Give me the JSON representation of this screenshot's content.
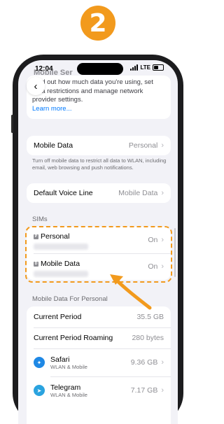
{
  "step": {
    "number": "2"
  },
  "status_bar": {
    "time": "12:04",
    "network": "LTE",
    "icons": [
      "signal-icon",
      "battery-icon"
    ]
  },
  "nav": {
    "title": "Mobile Ser",
    "back_icon": "chevron-left-icon"
  },
  "intro": {
    "text": "Find out how much data you're using, set data restrictions and manage network provider settings.",
    "learn_more": "Learn more..."
  },
  "mobile_data": {
    "label": "Mobile Data",
    "value": "Personal",
    "footnote": "Turn off mobile data to restrict all data to WLAN, including email, web browsing and push notifications."
  },
  "voice_line": {
    "label": "Default Voice Line",
    "value": "Mobile Data"
  },
  "sims": {
    "header": "SIMs",
    "items": [
      {
        "badge": "P",
        "label": "Personal",
        "status": "On"
      },
      {
        "badge": "D",
        "label": "Mobile Data",
        "status": "On"
      }
    ]
  },
  "usage": {
    "header": "Mobile Data For Personal",
    "current_period": {
      "label": "Current Period",
      "value": "35.5 GB"
    },
    "roaming": {
      "label": "Current Period Roaming",
      "value": "280 bytes"
    },
    "apps": [
      {
        "name": "Safari",
        "subtitle": "WLAN & Mobile",
        "value": "9.36 GB",
        "icon": "safari-icon",
        "color": "#1e88e5"
      },
      {
        "name": "Telegram",
        "subtitle": "WLAN & Mobile",
        "value": "7.17 GB",
        "icon": "telegram-icon",
        "color": "#2aa3df"
      }
    ]
  },
  "colors": {
    "accent": "#f29a1d",
    "link": "#007aff",
    "background": "#f2f2f7"
  }
}
